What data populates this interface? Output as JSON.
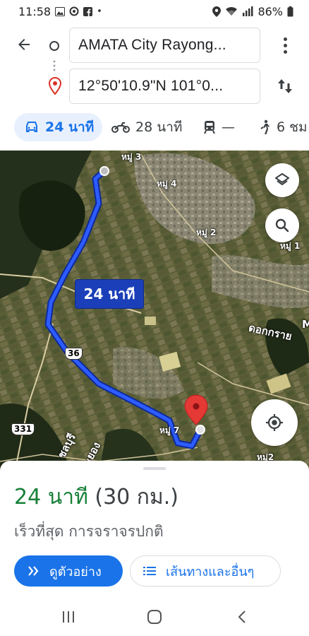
{
  "status_bar": {
    "time": "11:58",
    "dot": "•",
    "battery": "86%",
    "notification_icons": [
      "gallery-icon",
      "alarm-icon",
      "facebook-icon"
    ],
    "system_icons": [
      "location-icon",
      "wifi-icon",
      "signal-icon",
      "battery-icon"
    ]
  },
  "search": {
    "origin_text": "AMATA City Rayong...",
    "destination_text": "12°50'10.9\"N 101°0..."
  },
  "modes": [
    {
      "icon": "car-icon",
      "label": "24 นาที",
      "selected": true
    },
    {
      "icon": "motorcycle-icon",
      "label": "28 นาที",
      "selected": false
    },
    {
      "icon": "transit-icon",
      "label": "—",
      "selected": false
    },
    {
      "icon": "walk-icon",
      "label": "6 ชม",
      "selected": false
    }
  ],
  "map": {
    "route_badge": "24 นาที",
    "labels": [
      "หมู่ 3",
      "หมู่ 4",
      "หมู่ 2",
      "หมู่ 1",
      "ดอกกราย",
      "หมู่ 7",
      "หมู่2",
      "ชลบุรี",
      "ระยอง",
      "M"
    ],
    "road_shields": [
      "36",
      "331"
    ],
    "route_color": "#1a3fd6",
    "buttons": [
      "layers-icon",
      "search-icon",
      "my-location-icon"
    ]
  },
  "sheet": {
    "eta_time": "24 นาที",
    "eta_distance": "(30 กม.)",
    "summary": "เร็วที่สุด การจราจรปกติ",
    "preview_label": "ดูตัวอย่าง",
    "more_label": "เส้นทางและอื่นๆ",
    "accent_green": "#188038",
    "accent_blue": "#1a73e8"
  },
  "nav_bar": [
    "recents-icon",
    "home-icon",
    "back-icon"
  ]
}
